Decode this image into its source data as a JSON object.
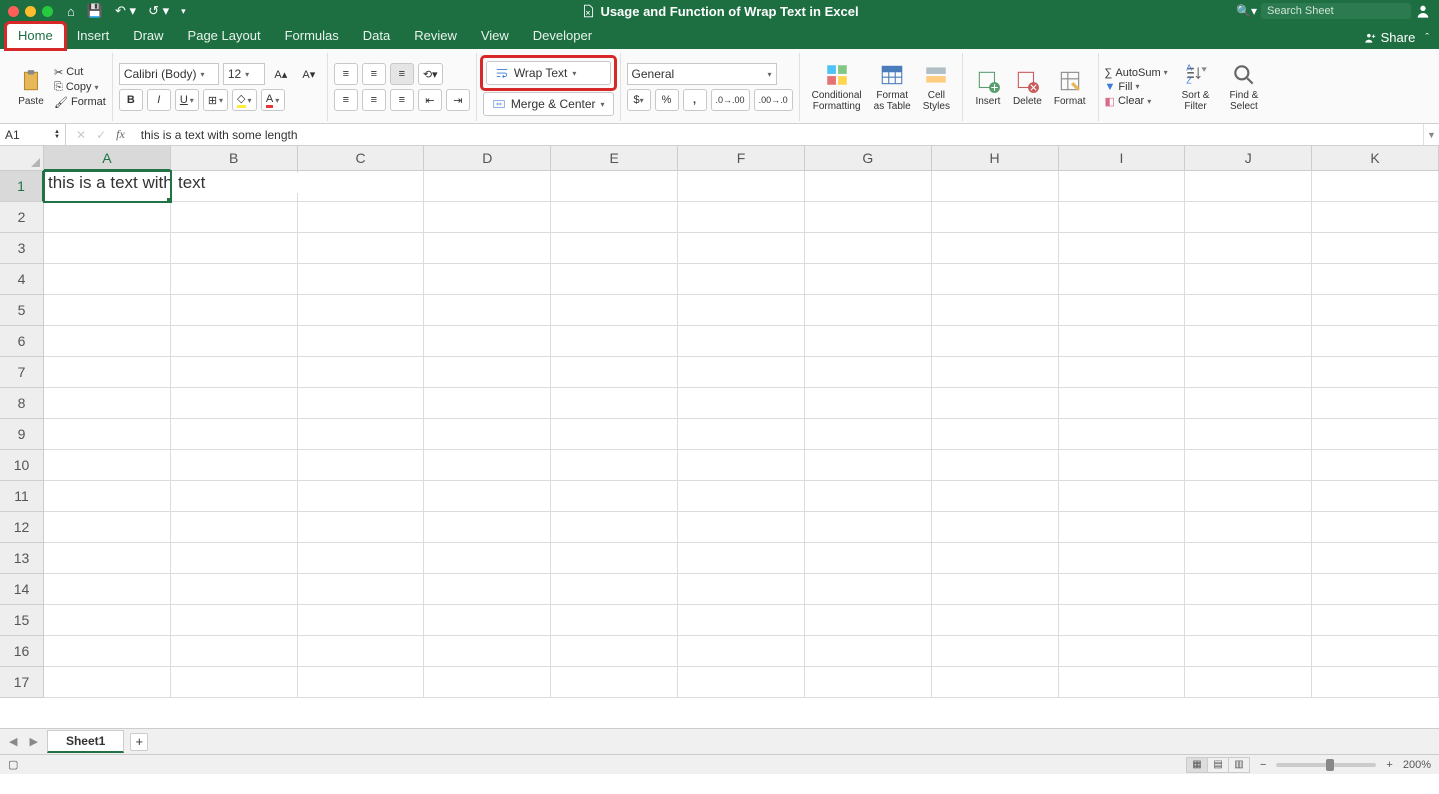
{
  "title": "Usage and Function of Wrap Text in Excel",
  "search_placeholder": "Search Sheet",
  "tabs": {
    "home": "Home",
    "insert": "Insert",
    "draw": "Draw",
    "page_layout": "Page Layout",
    "formulas": "Formulas",
    "data": "Data",
    "review": "Review",
    "view": "View",
    "developer": "Developer"
  },
  "share_label": "Share",
  "ribbon": {
    "paste": "Paste",
    "cut": "Cut",
    "copy": "Copy",
    "format_painter": "Format",
    "font_name": "Calibri (Body)",
    "font_size": "12",
    "wrap_text": "Wrap Text",
    "merge_center": "Merge & Center",
    "number_format": "General",
    "cond_fmt": "Conditional\nFormatting",
    "fmt_table": "Format\nas Table",
    "cell_styles": "Cell\nStyles",
    "insert": "Insert",
    "delete": "Delete",
    "format": "Format",
    "autosum": "AutoSum",
    "fill": "Fill",
    "clear": "Clear",
    "sort_filter": "Sort &\nFilter",
    "find_select": "Find &\nSelect"
  },
  "name_box": "A1",
  "formula_value": "this is a text with some length",
  "columns": [
    "A",
    "B",
    "C",
    "D",
    "E",
    "F",
    "G",
    "H",
    "I",
    "J",
    "K"
  ],
  "rows": [
    "1",
    "2",
    "3",
    "4",
    "5",
    "6",
    "7",
    "8",
    "9",
    "10",
    "11",
    "12",
    "13",
    "14",
    "15",
    "16",
    "17"
  ],
  "a1_display": "this is a text with some length",
  "a1_visible": "this is a text v",
  "b1_value": "text",
  "sheet_name": "Sheet1",
  "zoom": "200%"
}
